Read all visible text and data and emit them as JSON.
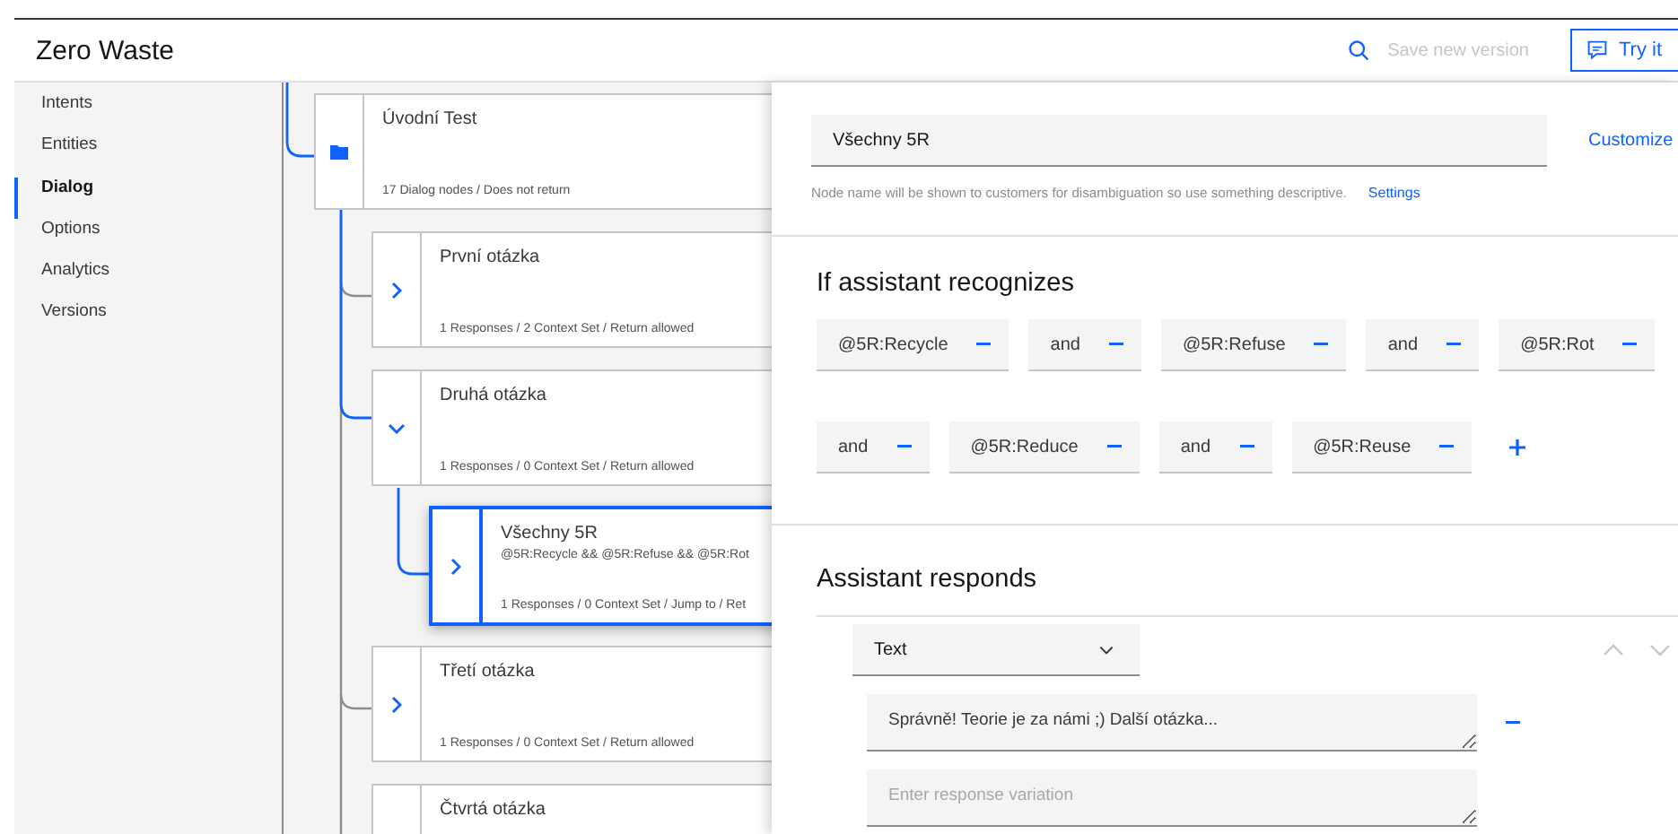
{
  "app": {
    "title": "Zero Waste"
  },
  "toolbar": {
    "save_label": "Save new version",
    "save_disabled": true,
    "try_label": "Try it"
  },
  "sidebar": {
    "items": [
      {
        "label": "Intents",
        "selected": false
      },
      {
        "label": "Entities",
        "selected": false
      },
      {
        "label": "Dialog",
        "selected": true
      },
      {
        "label": "Options",
        "selected": false
      },
      {
        "label": "Analytics",
        "selected": false
      },
      {
        "label": "Versions",
        "selected": false
      }
    ]
  },
  "tree": [
    {
      "title": "Úvodní Test",
      "summary": "17 Dialog nodes / Does not return",
      "kind": "folder",
      "selected": false,
      "children": [
        {
          "title": "První otázka",
          "summary": "1 Responses / 2 Context Set / Return allowed",
          "kind": "collapsed",
          "selected": false
        },
        {
          "title": "Druhá otázka",
          "summary": "1 Responses / 0 Context Set / Return allowed",
          "kind": "expanded",
          "selected": false,
          "children": [
            {
              "title": "Všechny 5R",
              "condition": "@5R:Recycle && @5R:Refuse && @5R:Rot",
              "summary": "1 Responses / 0 Context Set / Jump to / Ret",
              "kind": "collapsed",
              "selected": true
            }
          ]
        },
        {
          "title": "Třetí otázka",
          "summary": "1 Responses / 0 Context Set / Return allowed",
          "kind": "collapsed",
          "selected": false
        },
        {
          "title": "Čtvrtá otázka",
          "selected": false
        }
      ]
    }
  ],
  "editor": {
    "node_name": "Všechny 5R",
    "customize_link": "Customize",
    "help_text": "Node name will be shown to customers for disambiguation so use something descriptive.",
    "settings_link": "Settings",
    "conditions_title": "If assistant recognizes",
    "condition_rows": [
      [
        "@5R:Recycle",
        "and",
        "@5R:Refuse",
        "and",
        "@5R:Rot"
      ],
      [
        "and",
        "@5R:Reduce",
        "and",
        "@5R:Reuse"
      ]
    ],
    "responds_title": "Assistant responds",
    "response_type": "Text",
    "responses": [
      {
        "value": "Správně! Teorie je za námi ;) Další otázka..."
      },
      {
        "placeholder": "Enter response variation"
      }
    ]
  }
}
